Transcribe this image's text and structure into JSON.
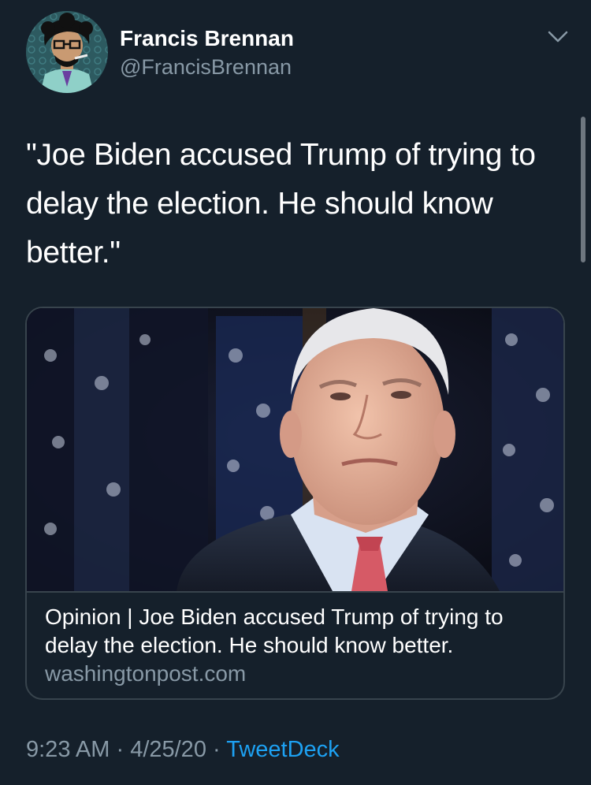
{
  "author": {
    "name": "Francis Brennan",
    "handle": "@FrancisBrennan",
    "avatar_icon": "cartoon-avatar-icon"
  },
  "tweet": {
    "text": "\"Joe Biden accused Trump of trying to delay the election. He should know better.\""
  },
  "link_card": {
    "image_icon": "news-photo-image",
    "title": "Opinion | Joe Biden accused Trump of trying to delay the election. He should know better.",
    "domain": "washingtonpost.com"
  },
  "meta": {
    "time": "9:23 AM",
    "separator": " · ",
    "date": "4/25/20",
    "source": "TweetDeck"
  },
  "colors": {
    "background": "#15202b",
    "secondary_text": "#8899a6",
    "link": "#1da1f2",
    "border": "#38444d"
  }
}
